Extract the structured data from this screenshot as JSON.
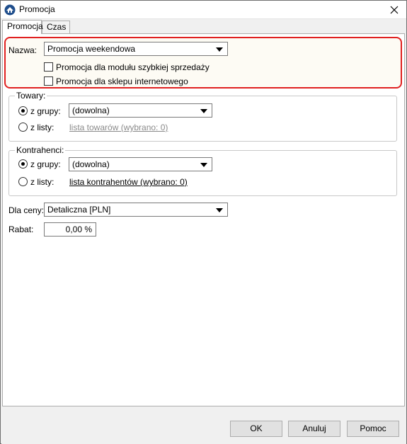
{
  "window": {
    "title": "Promocja"
  },
  "tabs": [
    {
      "label": "Promocja"
    },
    {
      "label": "Czas"
    }
  ],
  "nazwa": {
    "label": "Nazwa:",
    "value": "Promocja weekendowa",
    "options": [
      {
        "label": "Promocja dla modułu szybkiej sprzedaży",
        "checked": false
      },
      {
        "label": "Promocja dla sklepu internetowego",
        "checked": false
      }
    ]
  },
  "towary": {
    "title": "Towary:",
    "z_grupy_label": "z grupy:",
    "z_grupy_value": "(dowolna)",
    "z_listy_label": "z listy:",
    "z_listy_link": "lista towarów (wybrano: 0)"
  },
  "kontrahenci": {
    "title": "Kontrahenci:",
    "z_grupy_label": "z grupy:",
    "z_grupy_value": "(dowolna)",
    "z_listy_label": "z listy:",
    "z_listy_link": "lista kontrahentów (wybrano: 0)"
  },
  "cena": {
    "label": "Dla ceny:",
    "value": "Detaliczna [PLN]"
  },
  "rabat": {
    "label": "Rabat:",
    "value": "0,00 %"
  },
  "buttons": {
    "ok": "OK",
    "cancel": "Anuluj",
    "help": "Pomoc"
  },
  "colors": {
    "highlight_border": "#e02020",
    "link_muted": "#8a8a8a"
  }
}
